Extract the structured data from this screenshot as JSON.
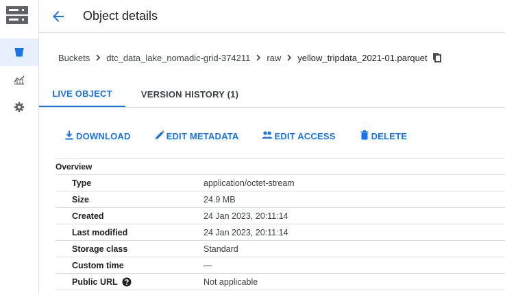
{
  "header": {
    "title": "Object details"
  },
  "breadcrumb": {
    "items": [
      "Buckets",
      "dtc_data_lake_nomadic-grid-374211",
      "raw",
      "yellow_tripdata_2021-01.parquet"
    ]
  },
  "tabs": [
    {
      "label": "LIVE OBJECT",
      "active": true
    },
    {
      "label": "VERSION HISTORY (1)",
      "active": false
    }
  ],
  "actions": {
    "download": "DOWNLOAD",
    "edit_metadata": "EDIT METADATA",
    "edit_access": "EDIT ACCESS",
    "delete": "DELETE"
  },
  "overview": {
    "heading": "Overview",
    "rows": [
      {
        "label": "Type",
        "value": "application/octet-stream"
      },
      {
        "label": "Size",
        "value": "24.9 MB"
      },
      {
        "label": "Created",
        "value": "24 Jan 2023, 20:11:14"
      },
      {
        "label": "Last modified",
        "value": "24 Jan 2023, 20:11:14"
      },
      {
        "label": "Storage class",
        "value": "Standard"
      },
      {
        "label": "Custom time",
        "value": "—"
      },
      {
        "label": "Public URL",
        "value": "Not applicable"
      }
    ]
  },
  "colors": {
    "accent": "#1a73e8",
    "icon_gray": "#5f6368",
    "rail_active_bg": "#e8f0fe",
    "divider": "#dadce0"
  },
  "icons": {
    "rail_logo": "storage-logo-icon",
    "rail_items": [
      "bucket-icon",
      "monitoring-chart-icon",
      "gear-icon"
    ],
    "back": "arrow-back-icon",
    "copy": "copy-icon",
    "help": "help-circle-icon"
  }
}
